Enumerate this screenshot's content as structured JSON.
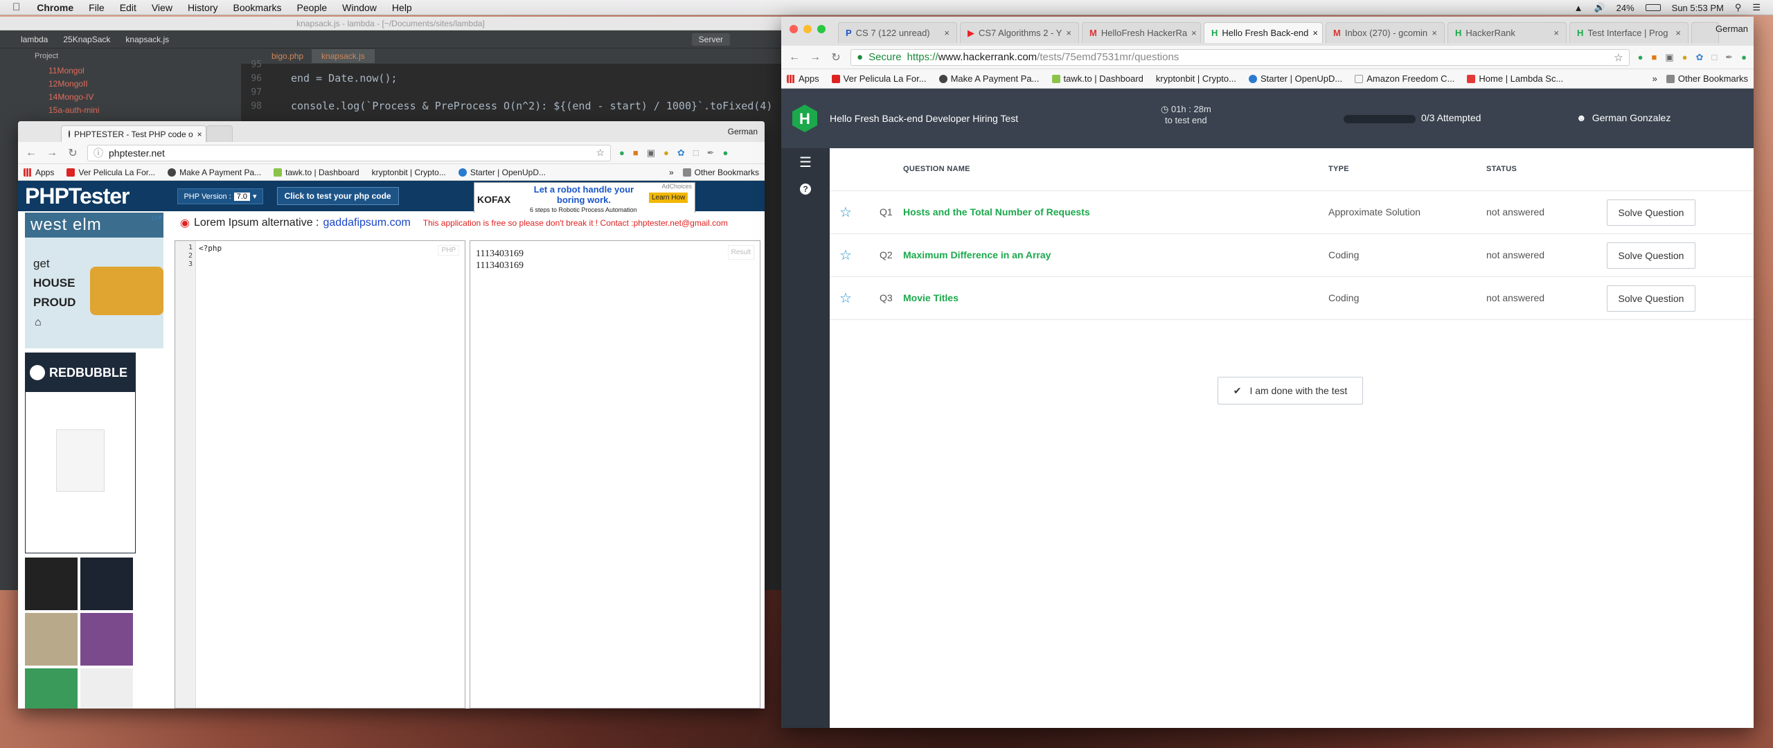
{
  "menubar": {
    "app": "Chrome",
    "items": [
      "File",
      "Edit",
      "View",
      "History",
      "Bookmarks",
      "People",
      "Window",
      "Help"
    ],
    "battery": "24%",
    "clock": "Sun 5:53 PM"
  },
  "ide": {
    "title": "knapsack.js - lambda - [~/Documents/sites/lambda]",
    "breadcrumbs": [
      "lambda",
      "25KnapSack",
      "knapsack.js"
    ],
    "project_label": "Project",
    "server_label": "Server",
    "tabs": [
      "bigo.php",
      "knapsack.js"
    ],
    "folders": [
      "11Mongol",
      "12MongoII",
      "14Mongo-IV",
      "15a-auth-mini"
    ],
    "line_numbers": [
      "95",
      "96",
      "97",
      "98"
    ],
    "code_line_96": "end = Date.now();",
    "code_line_98": "console.log(`Process & PreProcess O(n^2): ${(end - start) / 1000}`.toFixed(4)"
  },
  "php_window": {
    "tab_title": "PHPTESTER - Test PHP code o",
    "profile": "German",
    "url": "phptester.net",
    "bookmarks": [
      "Apps",
      "Ver Pelicula La For...",
      "Make A Payment Pa...",
      "tawk.to | Dashboard",
      "kryptonbit | Crypto...",
      "Starter | OpenUpD..."
    ],
    "other_bookmarks": "Other Bookmarks",
    "logo": "PHPTester",
    "php_version_label": "PHP Version :",
    "php_version": "7.0",
    "test_button": "Click to test your php code",
    "ad_kofax": {
      "brand": "KOFAX",
      "headline": "Let a robot handle your boring work.",
      "sub": "6 steps to Robotic Process Automation",
      "cta": "Learn How",
      "adchoices": "AdChoices"
    },
    "ad_westelm": {
      "brand": "west elm",
      "line1": "get",
      "line2": "HOUSE",
      "line3": "PROUD"
    },
    "ad_redbubble": {
      "brand": "REDBUBBLE"
    },
    "lorem_prefix": "Lorem Ipsum alternative :",
    "lorem_link": "gaddafipsum.com",
    "notice": "This application is free so please don't break it ! Contact :phptester.net@gmail.com",
    "editor_label": "PHP",
    "result_label": "Result",
    "code_lines": [
      "1",
      "2",
      "3"
    ],
    "code": "<?php",
    "results": [
      "1113403169",
      "1113403169"
    ]
  },
  "hr_window": {
    "tabs": [
      "CS 7 (122 unread)",
      "CS7 Algorithms 2 - Y",
      "HelloFresh HackerRa",
      "Hello Fresh Back-end",
      "Inbox (270) - gcomin",
      "HackerRank",
      "Test Interface | Prog"
    ],
    "profile": "German",
    "secure": "Secure",
    "url_scheme": "https://",
    "url_host": "www.hackerrank.com",
    "url_path": "/tests/75emd7531mr/questions",
    "bookmarks": [
      "Apps",
      "Ver Pelicula La For...",
      "Make A Payment Pa...",
      "tawk.to | Dashboard",
      "kryptonbit | Crypto...",
      "Starter | OpenUpD...",
      "Amazon Freedom C...",
      "Home | Lambda Sc..."
    ],
    "other_bookmarks": "Other Bookmarks",
    "test_name": "Hello Fresh Back-end Developer Hiring Test",
    "timer": "01h : 28m",
    "timer_sub": "to test end",
    "progress": 0.0,
    "attempted": "0/3 Attempted",
    "user": "German Gonzalez",
    "columns": {
      "name": "QUESTION NAME",
      "type": "TYPE",
      "status": "STATUS"
    },
    "questions": [
      {
        "num": "Q1",
        "title": "Hosts and the Total Number of Requests",
        "type": "Approximate Solution",
        "status": "not answered",
        "button": "Solve Question"
      },
      {
        "num": "Q2",
        "title": "Maximum Difference in an Array",
        "type": "Coding",
        "status": "not answered",
        "button": "Solve Question"
      },
      {
        "num": "Q3",
        "title": "Movie Titles",
        "type": "Coding",
        "status": "not answered",
        "button": "Solve Question"
      }
    ],
    "done_button": "I am done with the test"
  }
}
